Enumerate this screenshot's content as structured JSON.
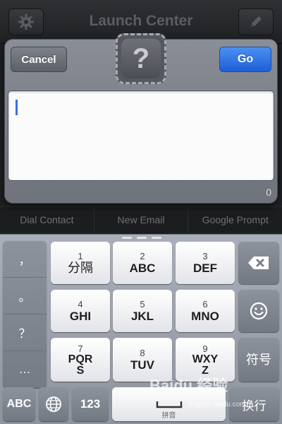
{
  "navbar": {
    "title": "Launch Center",
    "left_icon": "gear-icon",
    "right_icon": "pencil-icon"
  },
  "background_row": [
    "Dial Contact",
    "New Email",
    "Google Prompt"
  ],
  "dialog": {
    "cancel_label": "Cancel",
    "go_label": "Go",
    "icon_glyph": "?",
    "text_value": "",
    "char_count": "0"
  },
  "keyboard": {
    "punctuation": [
      "，",
      "。",
      "？",
      "…"
    ],
    "keys": [
      {
        "num": "1",
        "letters": "分隔"
      },
      {
        "num": "2",
        "letters": "ABC"
      },
      {
        "num": "3",
        "letters": "DEF"
      },
      {
        "num": "4",
        "letters": "GHI"
      },
      {
        "num": "5",
        "letters": "JKL"
      },
      {
        "num": "6",
        "letters": "MNO"
      },
      {
        "num": "7",
        "letters": "PQR S"
      },
      {
        "num": "8",
        "letters": "TUV"
      },
      {
        "num": "9",
        "letters": "WXY Z"
      }
    ],
    "delete_icon": "backspace-icon",
    "emoji_icon": "emoji-icon",
    "symbols_label": "符号",
    "abc_label": "ABC",
    "globe_icon": "globe-icon",
    "num_label": "123",
    "space_sub": "拼音",
    "return_label": "换行"
  },
  "watermark": {
    "text": "Baidu 经验",
    "sub": "jingyan.baidu.com"
  },
  "colors": {
    "go_blue": "#1e5fd6",
    "caret_blue": "#3a6fe0"
  }
}
